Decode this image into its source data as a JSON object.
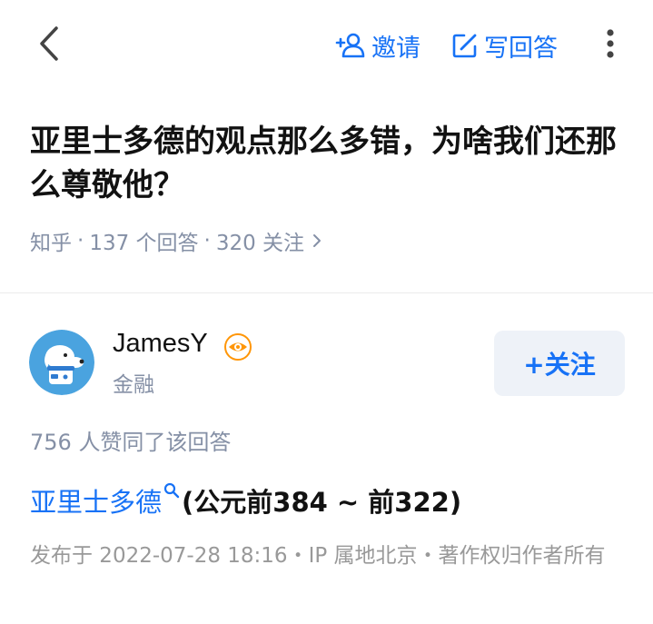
{
  "toolbar": {
    "back_icon": "chevron-left-icon",
    "invite_label": "邀请",
    "write_label": "写回答",
    "more_icon": "more-vertical-icon",
    "accent": "#1772f6"
  },
  "question": {
    "title": "亚里士多德的观点那么多错，为啥我们还那么尊敬他？",
    "source": "知乎",
    "answers_count": "137 个回答",
    "followers_count": "320 关注",
    "sep": "·"
  },
  "author": {
    "name": "JamesY",
    "tag": "金融",
    "follow_label": "+关注",
    "badge_icon": "eye-badge-icon"
  },
  "answer": {
    "votes": "756 人赞同了该回答",
    "link_text": "亚里士多德",
    "rest_text": "(公元前384 ~ 前322)",
    "publish_info": "发布于 2022-07-28 18:16・IP 属地北京・著作权归作者所有"
  }
}
